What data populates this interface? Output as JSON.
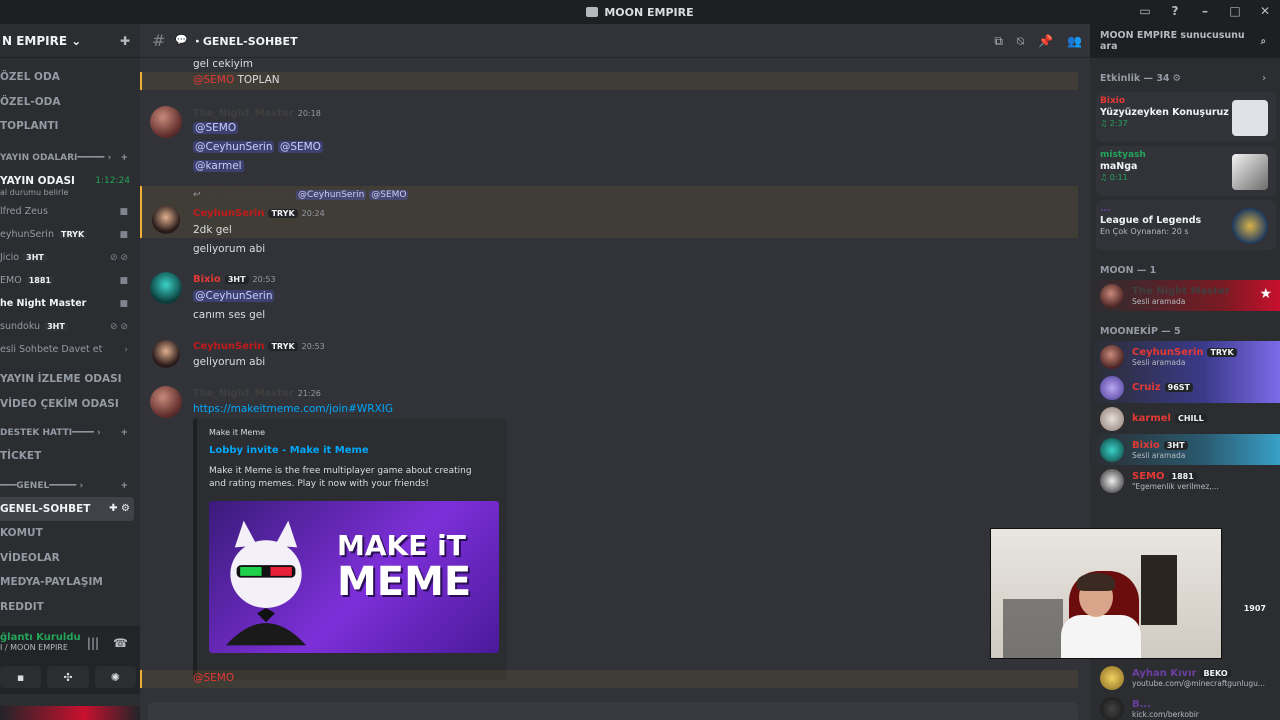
{
  "window": {
    "title": "MOON EMPIRE"
  },
  "server": {
    "name": "N EMPIRE"
  },
  "channels": [
    {
      "label": "ÖZEL ODA",
      "type": "text"
    },
    {
      "label": "ÖZEL-ODA",
      "type": "text"
    },
    {
      "label": "TOPLANTI",
      "type": "text"
    }
  ],
  "categories": {
    "yayin": "YAYIN ODALARI",
    "destek": "DESTEK HATTI",
    "genel": "GENEL"
  },
  "yayin_odasi": {
    "label": "YAYIN ODASI",
    "timer": "1:12:24",
    "sub": "al durumu belirle"
  },
  "voice_users": [
    {
      "name": "lfred Zeus",
      "tag": ""
    },
    {
      "name": "eyhunSerin",
      "tag": "TRYK"
    },
    {
      "name": "Jicio",
      "tag": "3HT"
    },
    {
      "name": "EMO",
      "tag": "1881"
    },
    {
      "name": "he Night Master",
      "tag": ""
    },
    {
      "name": "sundoku",
      "tag": "3HT"
    },
    {
      "name": "esli Sohbete Davet et",
      "tag": ""
    }
  ],
  "more_channels": [
    {
      "label": "YAYIN İZLEME ODASI"
    },
    {
      "label": "VİDEO ÇEKİM ODASI"
    },
    {
      "label": "TİCKET"
    },
    {
      "label": "GENEL-SOHBET"
    },
    {
      "label": "KOMUT"
    },
    {
      "label": "VİDEOLAR"
    },
    {
      "label": "MEDYA-PAYLAŞIM"
    },
    {
      "label": "REDDIT"
    }
  ],
  "voice_panel": {
    "status": "ğlantı Kuruldu",
    "sub": "I / MOON EMPIRE"
  },
  "header": {
    "channel": "GENEL-SOHBET",
    "search_placeholder": "MOON EMPIRE sunucusunu ara"
  },
  "messages": {
    "m0_text": "gel cekiyim",
    "m0b_mention": "@SEMO",
    "m0b_text": " TOPLAN",
    "m1_author": "The_Night_Master",
    "m1_time": "20:18",
    "m1_l1": "@SEMO",
    "m1_l2a": "@CeyhunSerin",
    "m1_l2b": "@SEMO",
    "m1_l3": "@karmel",
    "reply_author": "@The_Night_Master",
    "reply_m1": "@CeyhunSerin",
    "reply_m2": "@SEMO",
    "m2_author": "CeyhunSerin",
    "m2_tag": "TRYK",
    "m2_time": "20:24",
    "m2_l1": "2dk gel",
    "m2_l2": "geliyorum abi",
    "m3_author": "Bixio",
    "m3_tag": "3HT",
    "m3_time": "20:53",
    "m3_l1": "@CeyhunSerin",
    "m3_l2": "canım ses gel",
    "m4_author": "CeyhunSerin",
    "m4_tag": "TRYK",
    "m4_time": "20:53",
    "m4_l1": "geliyorum abi",
    "m5_author": "The_Night_Master",
    "m5_time": "21:26",
    "m5_link": "https://makeitmeme.com/join#WRXIG",
    "m6_mention": "@SEMO"
  },
  "embed": {
    "provider": "Make it Meme",
    "title": "Lobby invite - Make it Meme",
    "description": "Make it Meme is the free multiplayer game about creating and rating memes. Play it now with your friends!",
    "image_line1": "MAKE iT",
    "image_line2": "MEME"
  },
  "members_panel": {
    "activity_head": "Etkinlik — 34",
    "activities": [
      {
        "name": "Bixio",
        "title": "Yüzyüzeyken Konuşuruz",
        "detail": "♫ 2:37"
      },
      {
        "name": "mistyash",
        "title": "maNga",
        "detail": "♫ 0:11"
      },
      {
        "name": "...",
        "title": "League of Legends",
        "detail": "En Çok Oynanan: 20 s"
      }
    ],
    "moon_head": "MOON — 1",
    "moon_member": {
      "name": "The Night Master",
      "sub": "Sesli aramada"
    },
    "moonekip_head": "MOONEKİP — 5",
    "moonekip": [
      {
        "name": "CeyhunSerin",
        "tag": "TRYK",
        "sub": "Sesli aramada"
      },
      {
        "name": "Cruiz",
        "tag": "96ST",
        "sub": ""
      },
      {
        "name": "karmel",
        "tag": "CHILL",
        "sub": ""
      },
      {
        "name": "Bixio",
        "tag": "3HT",
        "sub": "Sesli aramada"
      },
      {
        "name": "SEMO",
        "tag": "1881",
        "sub": "\"Egemenlik verilmez,..."
      }
    ],
    "extra": [
      {
        "name": "Ayhan Kıvır",
        "tag": "BEKO",
        "sub": "youtube.com/@minecraftgunlugu..."
      },
      {
        "name": "B...",
        "tag": "",
        "sub": "kick.com/berkobir"
      }
    ],
    "extra_tag": "1907"
  }
}
